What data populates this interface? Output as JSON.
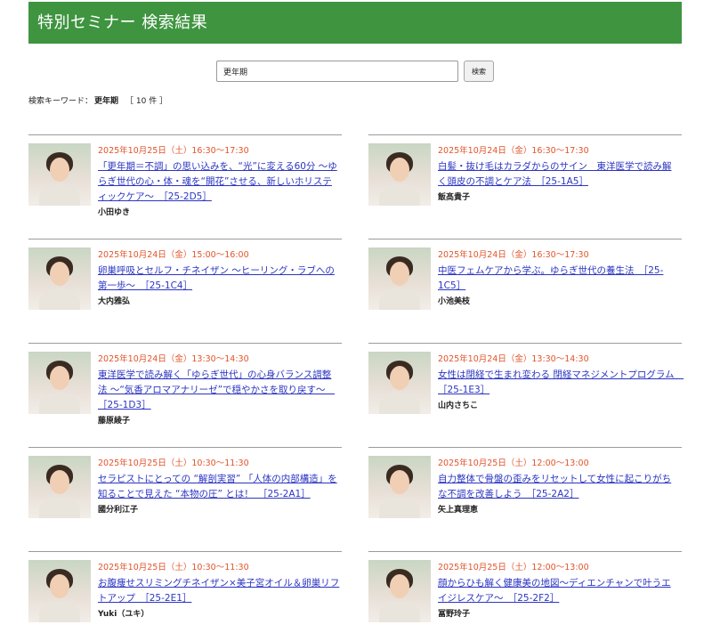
{
  "header": {
    "title": "特別セミナー 検索結果"
  },
  "search": {
    "value": "更年期",
    "button_label": "検索"
  },
  "summary": {
    "label": "検索キーワード：",
    "keyword": "更年期",
    "count": "［ 10 件 ］"
  },
  "results": [
    {
      "date": "2025年10月25日（土）16:30～17:30",
      "title": "「更年期＝不調」の思い込みを、“光”に変える60分 ～ゆらぎ世代の心・体・魂を“開花”させる、新しいホリスティックケア～　［25-2D5］",
      "speaker": "小田ゆき"
    },
    {
      "date": "2025年10月24日（金）16:30～17:30",
      "title": "白髪・抜け毛はカラダからのサイン　東洋医学で読み解く頭皮の不調とケア法　［25-1A5］",
      "speaker": "飯髙貴子"
    },
    {
      "date": "2025年10月24日（金）15:00～16:00",
      "title": "卵巣呼吸とセルフ・チネイザン ～ヒーリング・ラブへの第一歩～　［25-1C4］",
      "speaker": "大内雅弘"
    },
    {
      "date": "2025年10月24日（金）16:30～17:30",
      "title": "中医フェムケアから学ぶ。ゆらぎ世代の養生法　［25-1C5］",
      "speaker": "小池美枝"
    },
    {
      "date": "2025年10月24日（金）13:30～14:30",
      "title": "東洋医学で読み解く「ゆらぎ世代」の心身バランス調整法 ～“気香アロマアナリーゼ”で穏やかさを取り戻す～　［25-1D3］",
      "speaker": "藤原綾子"
    },
    {
      "date": "2025年10月24日（金）13:30～14:30",
      "title": "女性は閉経で生まれ変わる 閉経マネジメントプログラム　［25-1E3］",
      "speaker": "山内さちこ"
    },
    {
      "date": "2025年10月25日（土）10:30～11:30",
      "title": "セラピストにとっての “解剖実習” 「人体の内部構造」を知ることで見えた “本物の圧” とは！　［25-2A1］",
      "speaker": "國分利江子"
    },
    {
      "date": "2025年10月25日（土）12:00～13:00",
      "title": "自力整体で骨盤の歪みをリセットして女性に起こりがちな不調を改善しよう　［25-2A2］",
      "speaker": "矢上真理恵"
    },
    {
      "date": "2025年10月25日（土）10:30～11:30",
      "title": "お腹痩せスリミングチネイザン×美子宮オイル＆卵巣リフトアップ　［25-2E1］",
      "speaker": "Yuki（ユキ）"
    },
    {
      "date": "2025年10月25日（土）12:00～13:00",
      "title": "顔からひも解く健康美の地図～ディエンチャンで叶うエイジレスケア～　［25-2F2］",
      "speaker": "冨野玲子"
    }
  ]
}
